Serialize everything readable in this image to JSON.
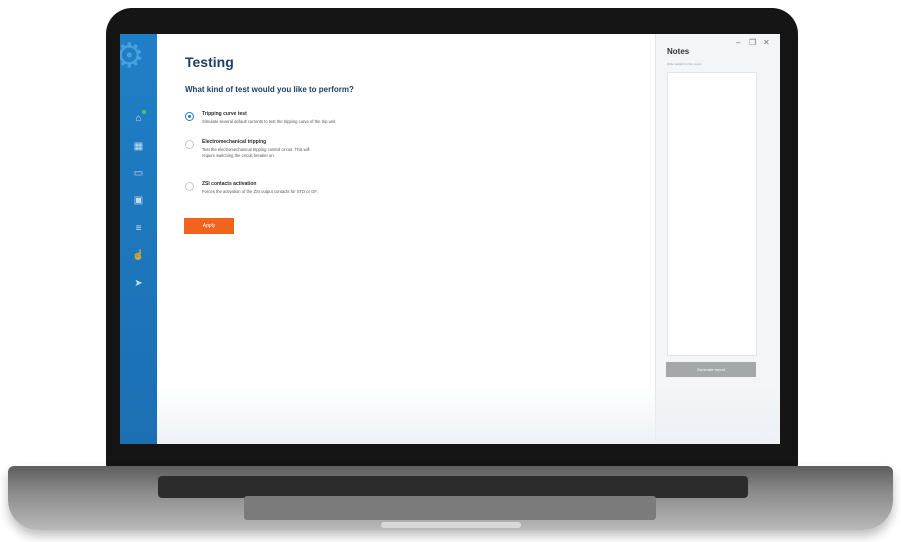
{
  "app": {
    "page_title": "Testing",
    "question": "What kind of test would you like to perform?",
    "apply_label": "Apply"
  },
  "sidebar": {
    "logo_icon": "gear-icon",
    "items": [
      {
        "icon": "home-icon"
      },
      {
        "icon": "building-icon"
      },
      {
        "icon": "folder-icon"
      },
      {
        "icon": "dashboard-icon"
      },
      {
        "icon": "analytics-icon"
      },
      {
        "icon": "touch-icon"
      },
      {
        "icon": "send-icon"
      }
    ]
  },
  "options": [
    {
      "title": "Tripping curve test",
      "description": "Simulate several default currents to test the tripping curve of the trip unit.",
      "selected": true
    },
    {
      "title": "Electromechanical tripping",
      "description": "Test the electromechanical tripping control circuit. This will require switching the circuit breaker on.",
      "selected": false
    },
    {
      "title": "ZSI contacts activation",
      "description": "Forces the activation of the ZSI output contacts for STD or GF.",
      "selected": false
    }
  ],
  "notes": {
    "title": "Notes",
    "hint": "Write details for the report",
    "generate_label": "Generate report"
  },
  "window_controls": {
    "minimize": "–",
    "restore": "❐",
    "close": "✕"
  },
  "colors": {
    "sidebar": "#1f7fc6",
    "accent": "#f0641e",
    "title": "#1e3f66",
    "radio_selected": "#1c78c8"
  }
}
